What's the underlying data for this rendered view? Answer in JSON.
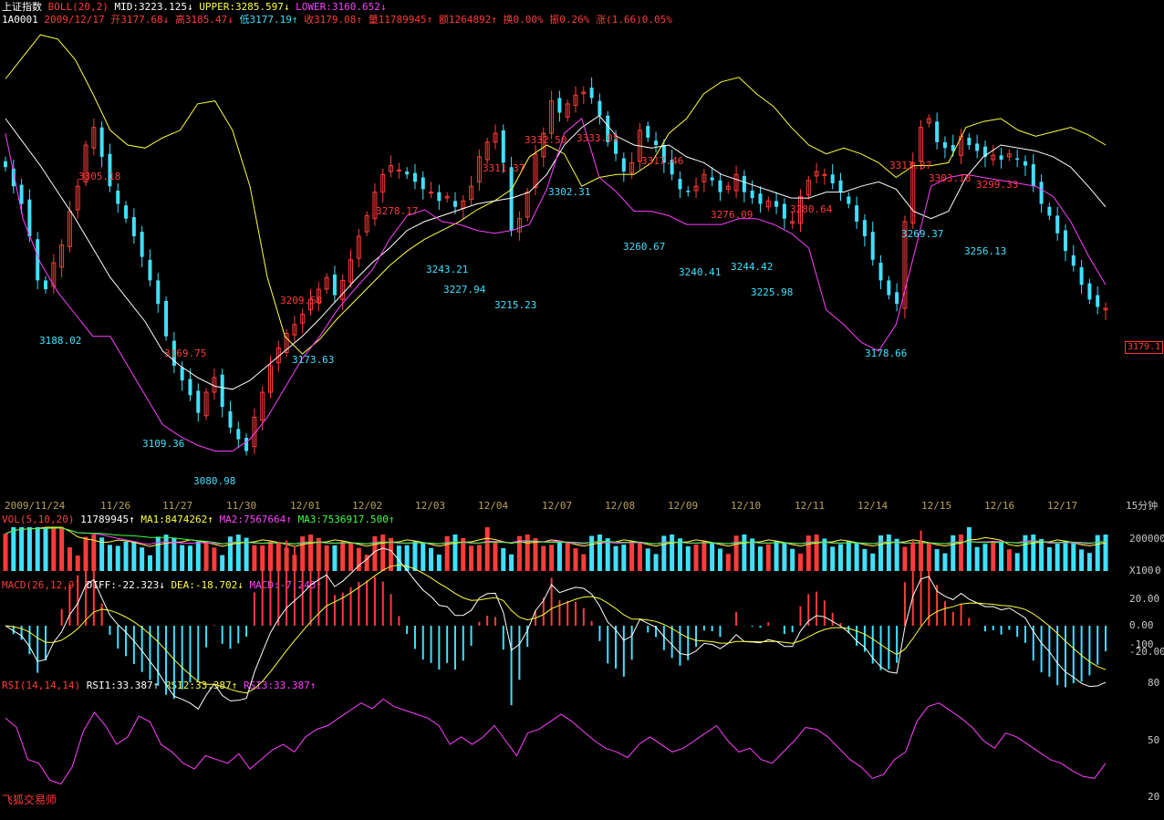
{
  "header": {
    "index_name": "上证指数",
    "boll_label": "BOLL(20,2)",
    "mid": "MID:3223.125↓",
    "upper": "UPPER:3285.597↓",
    "lower": "LOWER:3160.652↓",
    "code": "1A0001",
    "date": "2009/12/17",
    "open": "开3177.68↓",
    "high": "高3185.47↓",
    "low": "低3177.19↑",
    "close": "收3179.08↑",
    "volume": "量11789945↑",
    "amount": "额1264892↑",
    "turnover": "换0.00%",
    "amplitude": "振0.26%",
    "change": "涨(1.66)0.05%"
  },
  "vol_header": {
    "label": "VOL(5,10,20)",
    "value": "11789945↑",
    "ma1": "MA1:8474262↑",
    "ma2": "MA2:7567664↑",
    "ma3": "MA3:7536917.500↑"
  },
  "macd_header": {
    "label": "MACD(26,12,9)",
    "diff": "DIFF:-22.323↓",
    "dea": "DEA:-18.702↓",
    "macd": "MACD:-7.243↑"
  },
  "rsi_header": {
    "label": "RSI(14,14,14)",
    "rsi1": "RSI1:33.387↑",
    "rsi2": "RSI2:33.387↑",
    "rsi3": "RSI3:33.387↑"
  },
  "period": "15分钟",
  "brand": "飞狐交易师",
  "current_price": "3179.1",
  "colors": {
    "up": "#ff3b3b",
    "down": "#40e0ff",
    "upper": "#ffff40",
    "mid": "#ffffff",
    "lower": "#ff40ff",
    "bg": "#000000",
    "date": "#b8a05a"
  },
  "chart_data": [
    {
      "type": "candlestick",
      "title": "上证指数 BOLL(20,2)",
      "x_dates": [
        "2009/11/24",
        "11/26",
        "11/27",
        "11/30",
        "12/01",
        "12/02",
        "12/03",
        "12/04",
        "12/07",
        "12/08",
        "12/09",
        "12/10",
        "12/11",
        "12/14",
        "12/15",
        "12/16",
        "12/17"
      ],
      "y_range": [
        3060,
        3370
      ],
      "annotations_high": [
        "3305.18",
        "3169.75",
        "3209.58",
        "3278.17",
        "3311.37",
        "3332.50",
        "3333.05",
        "3317.46",
        "3276.09",
        "3280.64",
        "3313.37",
        "3303.18",
        "3299.33"
      ],
      "annotations_low": [
        "3188.02",
        "3109.36",
        "3080.98",
        "3173.63",
        "3243.21",
        "3227.94",
        "3215.23",
        "3302.31",
        "3260.67",
        "3240.41",
        "3244.42",
        "3225.98",
        "3178.66",
        "3269.37",
        "3256.13"
      ],
      "close_path": [
        3275,
        3262,
        3250,
        3228,
        3198,
        3192,
        3210,
        3222,
        3245,
        3262,
        3290,
        3302,
        3282,
        3262,
        3250,
        3240,
        3228,
        3214,
        3198,
        3182,
        3160,
        3140,
        3130,
        3120,
        3108,
        3122,
        3132,
        3112,
        3098,
        3090,
        3082,
        3105,
        3122,
        3140,
        3152,
        3162,
        3168,
        3175,
        3185,
        3192,
        3200,
        3188,
        3198,
        3212,
        3228,
        3242,
        3258,
        3270,
        3276,
        3273,
        3270,
        3265,
        3260,
        3258,
        3252,
        3255,
        3248,
        3252,
        3262,
        3282,
        3292,
        3298,
        3278,
        3232,
        3240,
        3258,
        3284,
        3298,
        3320,
        3312,
        3318,
        3324,
        3326,
        3322,
        3310,
        3292,
        3284,
        3272,
        3278,
        3300,
        3295,
        3290,
        3278,
        3270,
        3260,
        3258,
        3262,
        3270,
        3266,
        3258,
        3262,
        3270,
        3258,
        3254,
        3250,
        3252,
        3248,
        3240,
        3238,
        3255,
        3266,
        3272,
        3270,
        3264,
        3258,
        3250,
        3238,
        3228,
        3212,
        3198,
        3188,
        3182,
        3238,
        3278,
        3302,
        3308,
        3292,
        3288,
        3286,
        3296,
        3290,
        3286,
        3282,
        3283,
        3280,
        3284,
        3280,
        3276,
        3262,
        3250,
        3242,
        3230,
        3218,
        3208,
        3195,
        3185,
        3180,
        3179
      ],
      "series": [
        {
          "name": "UPPER",
          "values": [
            3335,
            3350,
            3365,
            3362,
            3348,
            3325,
            3300,
            3290,
            3288,
            3295,
            3300,
            3318,
            3320,
            3300,
            3262,
            3200,
            3160,
            3148,
            3158,
            3172,
            3184,
            3196,
            3208,
            3218,
            3226,
            3232,
            3238,
            3246,
            3252,
            3260,
            3282,
            3290,
            3284,
            3262,
            3268,
            3270,
            3270,
            3278,
            3298,
            3308,
            3325,
            3333,
            3336,
            3325,
            3316,
            3302,
            3290,
            3284,
            3288,
            3284,
            3278,
            3268,
            3276,
            3276,
            3278,
            3302,
            3306,
            3308,
            3300,
            3296,
            3299,
            3302,
            3297,
            3290
          ]
        },
        {
          "name": "MID",
          "values": [
            3308,
            3292,
            3276,
            3258,
            3240,
            3220,
            3200,
            3185,
            3170,
            3150,
            3140,
            3132,
            3126,
            3124,
            3130,
            3140,
            3150,
            3160,
            3172,
            3185,
            3198,
            3210,
            3220,
            3232,
            3238,
            3242,
            3246,
            3250,
            3252,
            3254,
            3258,
            3270,
            3290,
            3302,
            3310,
            3296,
            3290,
            3288,
            3290,
            3282,
            3278,
            3270,
            3266,
            3262,
            3258,
            3254,
            3254,
            3258,
            3258,
            3262,
            3265,
            3260,
            3245,
            3240,
            3245,
            3268,
            3282,
            3290,
            3288,
            3286,
            3282,
            3275,
            3262,
            3248
          ]
        },
        {
          "name": "LOWER",
          "values": [
            3298,
            3240,
            3210,
            3190,
            3175,
            3160,
            3160,
            3140,
            3120,
            3100,
            3092,
            3086,
            3082,
            3082,
            3090,
            3105,
            3125,
            3145,
            3160,
            3178,
            3192,
            3205,
            3226,
            3242,
            3246,
            3238,
            3236,
            3232,
            3230,
            3232,
            3236,
            3260,
            3298,
            3308,
            3268,
            3258,
            3245,
            3245,
            3242,
            3236,
            3236,
            3236,
            3240,
            3240,
            3236,
            3230,
            3220,
            3178,
            3168,
            3156,
            3150,
            3168,
            3214,
            3262,
            3268,
            3270,
            3268,
            3266,
            3264,
            3262,
            3255,
            3238,
            3215,
            3195
          ]
        }
      ]
    },
    {
      "type": "bar",
      "title": "VOL(5,10,20)",
      "y_ticks": [
        "200000",
        "0"
      ],
      "unit": "X100",
      "series": [
        {
          "name": "MA1"
        },
        {
          "name": "MA2"
        },
        {
          "name": "MA3"
        }
      ]
    },
    {
      "type": "line",
      "title": "MACD(26,12,9)",
      "y_ticks": [
        "20.00",
        "0.00",
        "-20.00",
        "-100"
      ],
      "series": [
        {
          "name": "DIFF"
        },
        {
          "name": "DEA"
        },
        {
          "name": "MACD"
        }
      ]
    },
    {
      "type": "line",
      "title": "RSI(14,14,14)",
      "y_ticks": [
        "80",
        "50",
        "20"
      ],
      "series": [
        {
          "name": "RSI1",
          "values": [
            62,
            57,
            40,
            38,
            29,
            27,
            36,
            55,
            65,
            58,
            48,
            52,
            63,
            60,
            48,
            44,
            38,
            35,
            42,
            40,
            38,
            43,
            35,
            40,
            45,
            48,
            44,
            52,
            56,
            58,
            62,
            66,
            70,
            67,
            72,
            68,
            66,
            64,
            62,
            58,
            48,
            52,
            48,
            52,
            58,
            50,
            42,
            54,
            56,
            60,
            64,
            60,
            55,
            50,
            46,
            44,
            41,
            48,
            52,
            48,
            44,
            46,
            50,
            54,
            58,
            50,
            44,
            46,
            40,
            38,
            44,
            50,
            57,
            56,
            52,
            46,
            40,
            36,
            30,
            32,
            40,
            44,
            60,
            68,
            70,
            66,
            62,
            57,
            50,
            46,
            54,
            52,
            48,
            44,
            40,
            38,
            34,
            31,
            30,
            38
          ]
        }
      ]
    }
  ]
}
